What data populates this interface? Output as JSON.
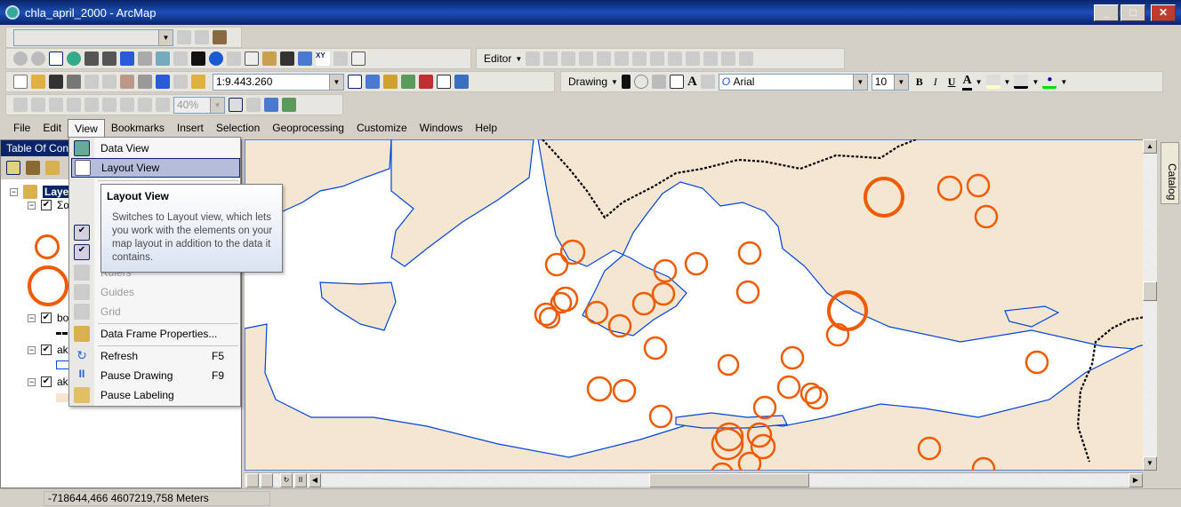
{
  "window": {
    "title": "chla_april_2000 - ArcMap",
    "controls": [
      "_",
      "□",
      "✕"
    ]
  },
  "toolbars": {
    "scale": "1:9.443.260",
    "editor_label": "Editor",
    "drawing_label": "Drawing",
    "font": "Arial",
    "font_size": "10",
    "zoom_percent": "40%",
    "bold": "B",
    "italic": "I",
    "underline": "U",
    "font_color": "#000000",
    "fill_color": "#ffffc0",
    "line_color": "#000000",
    "marker_color": "#00e000"
  },
  "menubar": {
    "items": [
      "File",
      "Edit",
      "View",
      "Bookmarks",
      "Insert",
      "Selection",
      "Geoprocessing",
      "Customize",
      "Windows",
      "Help"
    ]
  },
  "toc": {
    "title": "Table Of Con",
    "root": "Layer",
    "layers": [
      {
        "name": "Σα",
        "checked": true
      },
      {
        "name": "bo",
        "checked": true
      },
      {
        "name": "ak",
        "checked": true
      },
      {
        "name": "ak",
        "checked": true
      }
    ]
  },
  "view_menu": {
    "items": [
      {
        "label": "Data View",
        "shortcut": "",
        "enabled": true,
        "icon": "data-view-icon"
      },
      {
        "label": "Layout View",
        "shortcut": "",
        "enabled": true,
        "highlighted": true,
        "icon": "layout-view-icon"
      },
      {
        "label": "Rulers",
        "shortcut": "",
        "enabled": false,
        "icon": "rulers-icon"
      },
      {
        "label": "Guides",
        "shortcut": "",
        "enabled": false,
        "icon": "guides-icon"
      },
      {
        "label": "Grid",
        "shortcut": "",
        "enabled": false,
        "icon": "grid-icon"
      },
      {
        "label": "Data Frame Properties...",
        "shortcut": "",
        "enabled": true,
        "icon": "data-frame-properties-icon"
      },
      {
        "label": "Refresh",
        "shortcut": "F5",
        "enabled": true,
        "icon": "refresh-icon"
      },
      {
        "label": "Pause Drawing",
        "shortcut": "F9",
        "enabled": true,
        "icon": "pause-icon"
      },
      {
        "label": "Pause Labeling",
        "shortcut": "",
        "enabled": true,
        "icon": "pause-labeling-icon"
      }
    ]
  },
  "tooltip": {
    "title": "Layout View",
    "body": "Switches to Layout view, which lets you work with the elements on your map layout in addition to the data it contains."
  },
  "catalog_tab": "Catalog",
  "status": {
    "coordinates": "-718644,466  4607219,758 Meters"
  },
  "colors": {
    "land": "#f5e6d2",
    "coast": "#0044dd",
    "symbol": "#f05a00",
    "border": "#000000",
    "title_bar": "#0a246a"
  }
}
